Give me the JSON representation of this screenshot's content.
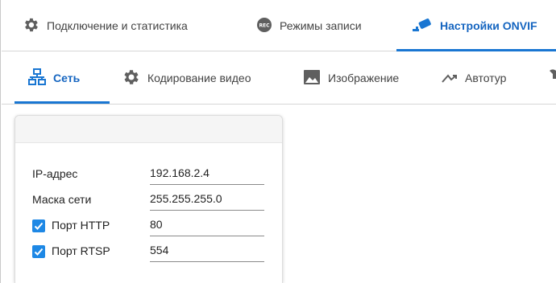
{
  "top_tabs": [
    {
      "label": "Подключение и статистика",
      "icon": "gear-icon"
    },
    {
      "label": "Режимы записи",
      "icon": "rec-icon"
    },
    {
      "label": "Настройки ONVIF",
      "icon": "camera-icon",
      "active": true
    }
  ],
  "sub_tabs": [
    {
      "label": "Сеть",
      "icon": "network-icon",
      "active": true
    },
    {
      "label": "Кодирование видео",
      "icon": "gear-icon"
    },
    {
      "label": "Изображение",
      "icon": "image-icon"
    },
    {
      "label": "Автотур",
      "icon": "route-icon"
    },
    {
      "label": "",
      "icon": "wrench-icon"
    }
  ],
  "network": {
    "ip": {
      "label": "IP-адрес",
      "value": "192.168.2.4"
    },
    "mask": {
      "label": "Маска сети",
      "value": "255.255.255.0"
    },
    "http": {
      "label": "Порт HTTP",
      "value": "80",
      "checked": true
    },
    "rtsp": {
      "label": "Порт RTSP",
      "value": "554",
      "checked": true
    }
  },
  "colors": {
    "accent": "#1976d2",
    "checkbox": "#1e88e5",
    "icon_gray": "#5f5f5f"
  }
}
